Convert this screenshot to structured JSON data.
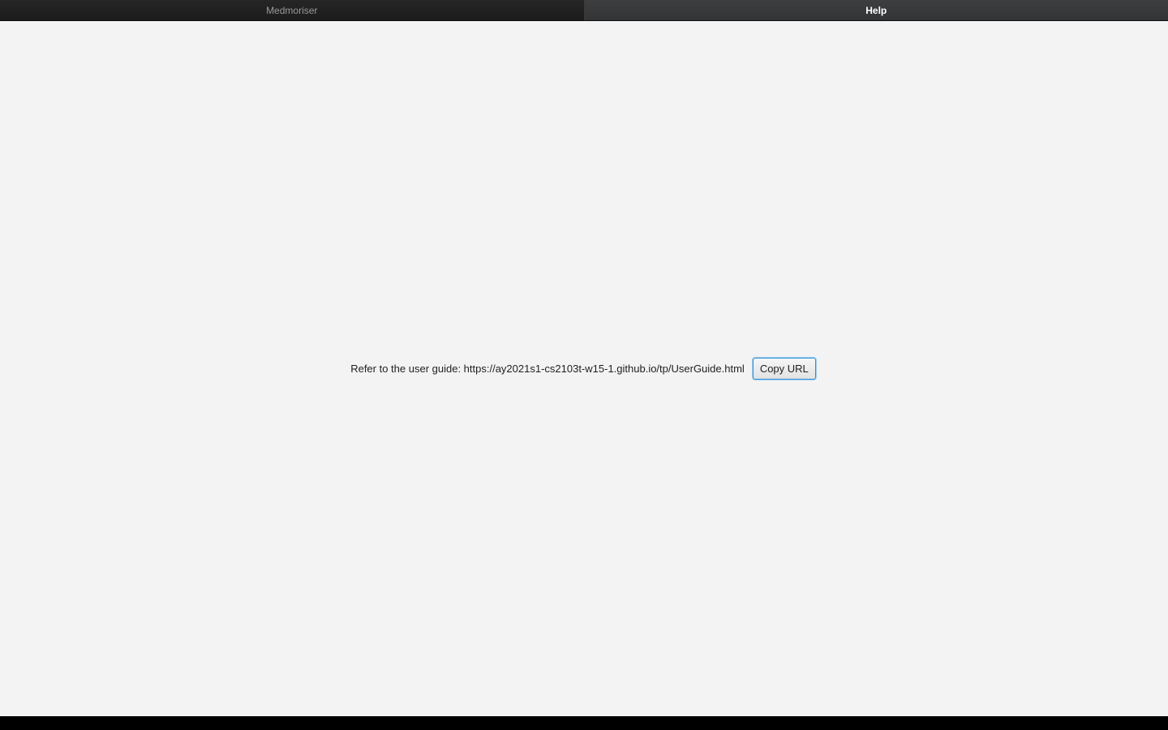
{
  "tabs": [
    {
      "label": "Medmoriser",
      "active": false
    },
    {
      "label": "Help",
      "active": true
    }
  ],
  "help": {
    "message": "Refer to the user guide: https://ay2021s1-cs2103t-w15-1.github.io/tp/UserGuide.html",
    "copy_button_label": "Copy URL"
  },
  "colors": {
    "content_background": "#f3f3f3",
    "tab_bar_background": "#1e1e1e",
    "button_focus_border": "#2f8fd6"
  }
}
